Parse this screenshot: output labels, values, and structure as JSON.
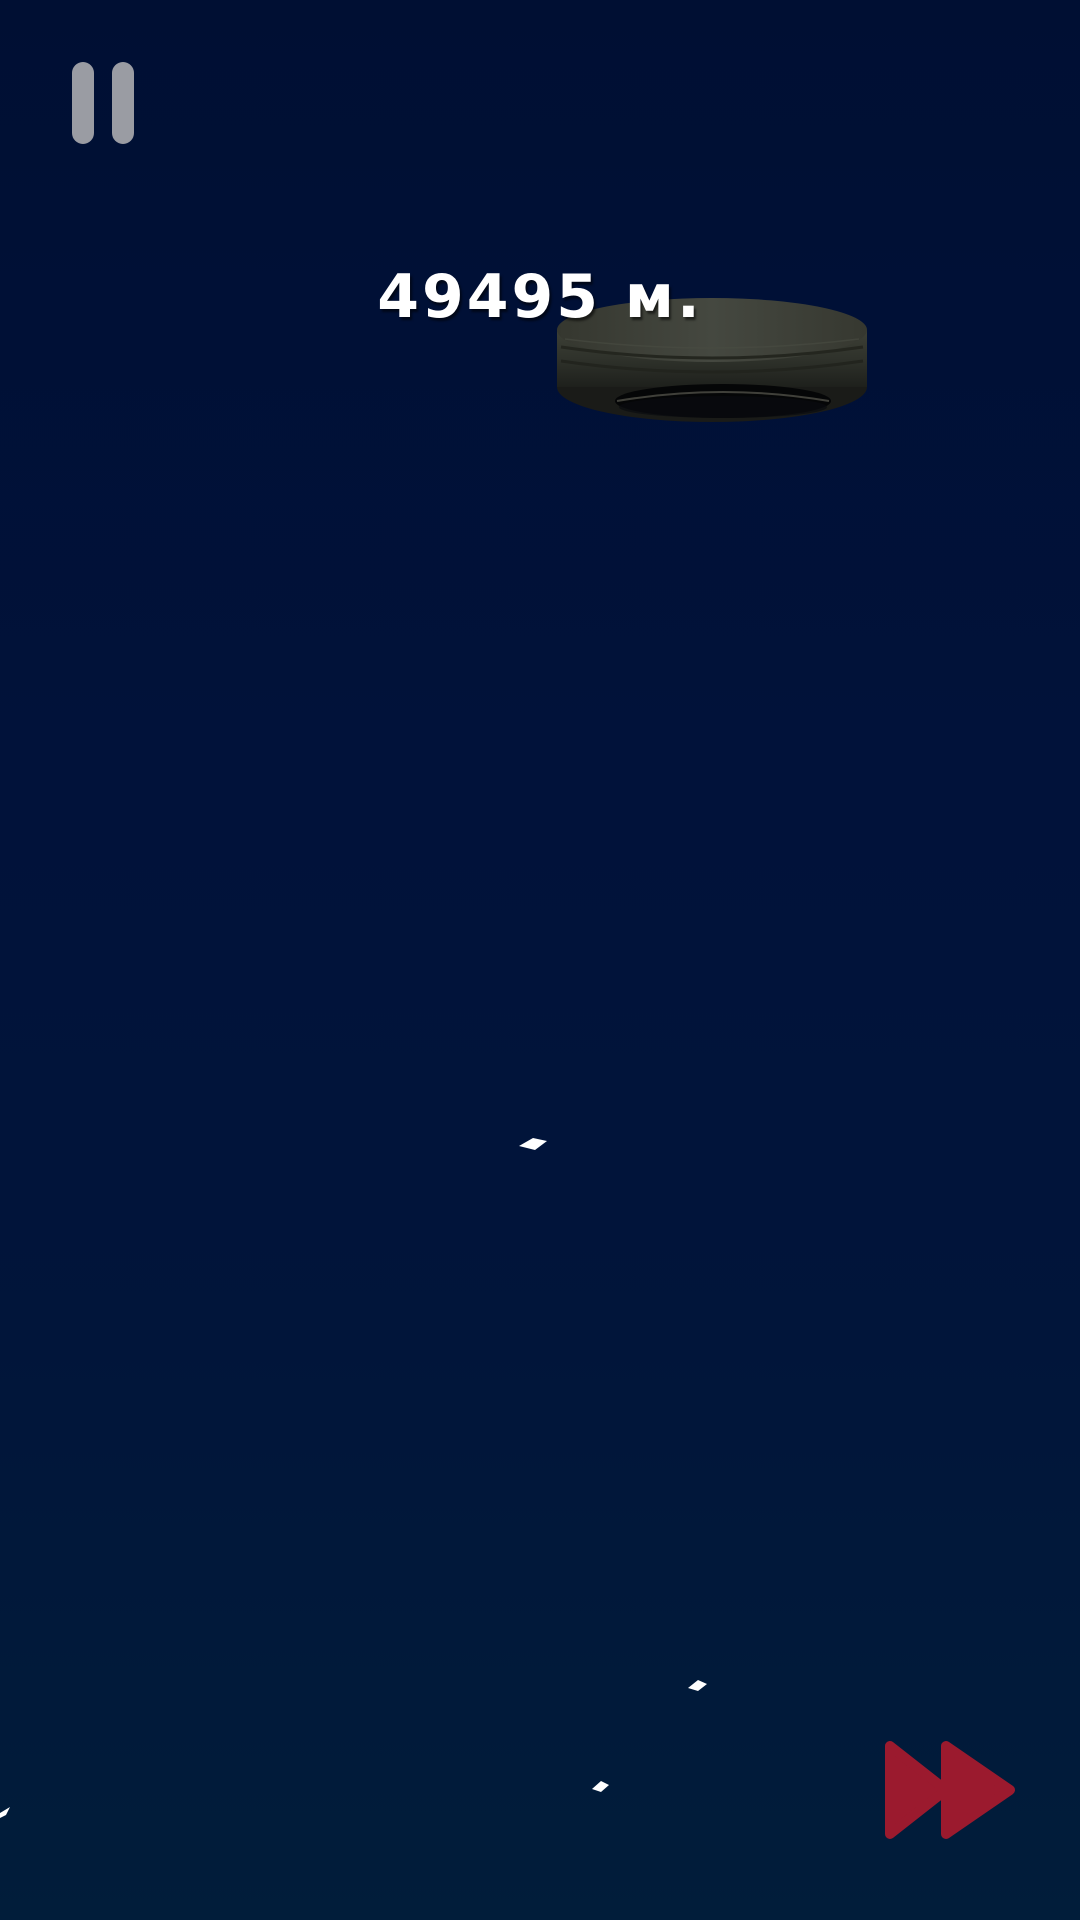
{
  "hud": {
    "distance_value": "49495",
    "distance_unit": "м.",
    "distance_text": "49495 м."
  },
  "controls": {
    "pause_icon": "pause-icon",
    "fast_forward_icon": "fast-forward-icon"
  },
  "scene": {
    "obstacle": "tire",
    "particle_count": 4
  },
  "colors": {
    "sky_top": "#000f33",
    "sky_bottom": "#011d3a",
    "pause_icon": "#9a9ca3",
    "fast_forward": "#9b1a2e",
    "text": "#ffffff"
  }
}
